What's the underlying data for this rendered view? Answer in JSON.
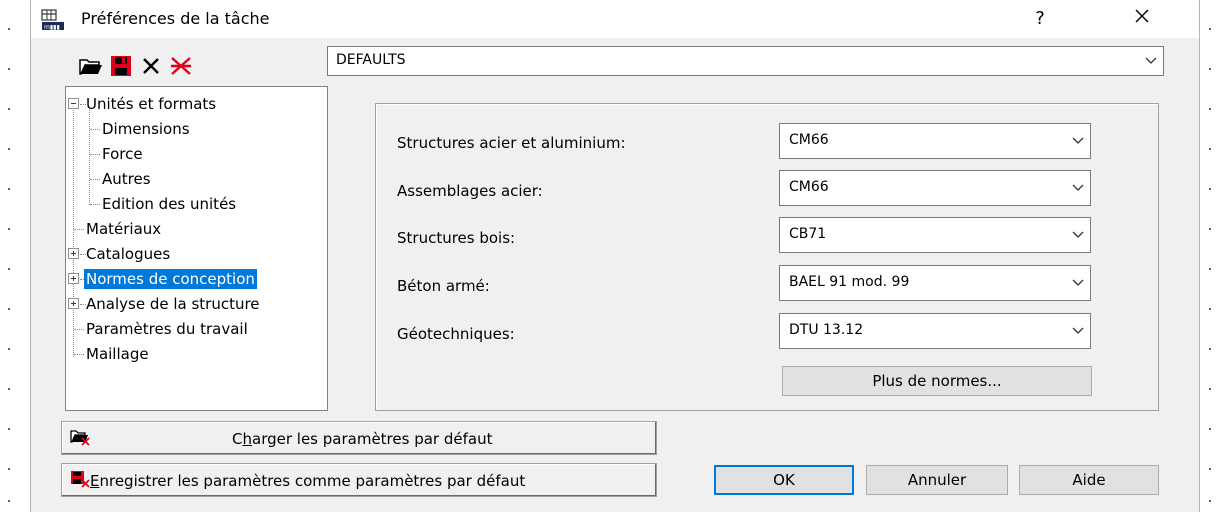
{
  "dialog": {
    "title": "Préférences de la tâche",
    "help_label": "?",
    "close_icon": "close-icon"
  },
  "toolbar": {
    "icons": [
      "open-folder-icon",
      "save-icon",
      "delete-icon",
      "reset-icon"
    ],
    "preset_value": "DEFAULTS"
  },
  "tree": {
    "units_formats": "Unités et formats",
    "dimensions": "Dimensions",
    "force": "Force",
    "others": "Autres",
    "unit_edit": "Edition des unités",
    "materials": "Matériaux",
    "catalogs": "Catalogues",
    "design_codes": "Normes de conception",
    "structure_analysis": "Analyse de la structure",
    "job_params": "Paramètres du travail",
    "meshing": "Maillage"
  },
  "codes": {
    "steel_label": "Structures acier et aluminium:",
    "steel_value": "CM66",
    "connections_label": "Assemblages acier:",
    "connections_value": "CM66",
    "timber_label": "Structures bois:",
    "timber_value": "CB71",
    "rc_label": "Béton armé:",
    "rc_value": "BAEL 91 mod. 99",
    "geotech_label": "Géotechniques:",
    "geotech_value": "DTU 13.12",
    "more_button": "Plus de normes..."
  },
  "buttons": {
    "load_defaults_pre": "C",
    "load_defaults_hot": "h",
    "load_defaults_post": "arger les paramètres par défaut",
    "save_defaults_hot": "E",
    "save_defaults_post": "nregistrer les paramètres comme paramètres par défaut",
    "ok": "OK",
    "cancel": "Annuler",
    "help": "Aide"
  },
  "colors": {
    "selection": "#0078d7",
    "icon_red": "#e0001b"
  }
}
